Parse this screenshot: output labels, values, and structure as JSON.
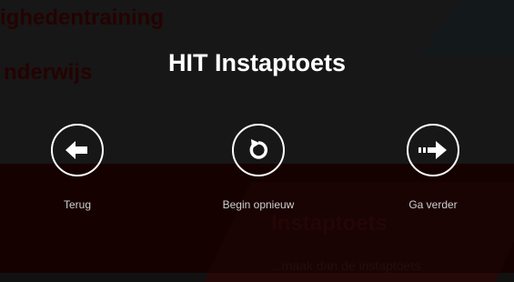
{
  "background": {
    "heading_1": "ighedentraining",
    "heading_2": "nderwijs",
    "section_title": "Instaptoets",
    "section_subtitle": "...maak dan de instaptoets"
  },
  "modal": {
    "title": "HIT Instaptoets",
    "buttons": [
      {
        "label": "Terug",
        "icon": "arrow-left-icon"
      },
      {
        "label": "Begin opnieuw",
        "icon": "restart-icon"
      },
      {
        "label": "Ga verder",
        "icon": "arrow-right-icon"
      }
    ]
  },
  "colors": {
    "overlay_text": "#ffffff",
    "background_accent": "#3c0404"
  }
}
